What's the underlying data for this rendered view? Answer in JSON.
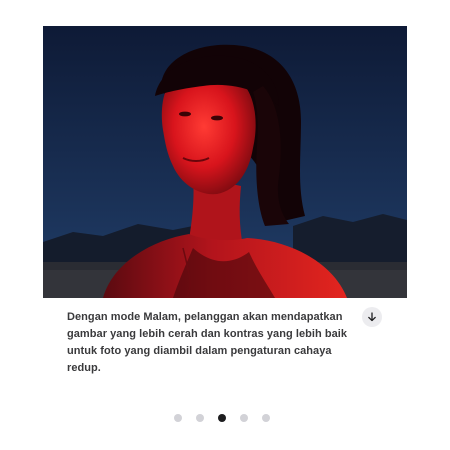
{
  "gallery": {
    "image_alt": "",
    "caption": "Dengan mode Malam, pelanggan akan mendapatkan gambar yang lebih cerah dan kontras yang lebih baik untuk foto yang diambil dalam pengaturan cahaya redup.",
    "expand_icon": "arrow-down-icon",
    "dots_count": 5,
    "active_dot": 3
  },
  "colors": {
    "sky_top": "#0f1d3d",
    "sky_bottom": "#1f3a63",
    "red_light": "#e11b22",
    "dot_inactive": "#d2d2d7",
    "dot_active": "#1d1d1f",
    "caption_text": "#3a3a3c"
  }
}
